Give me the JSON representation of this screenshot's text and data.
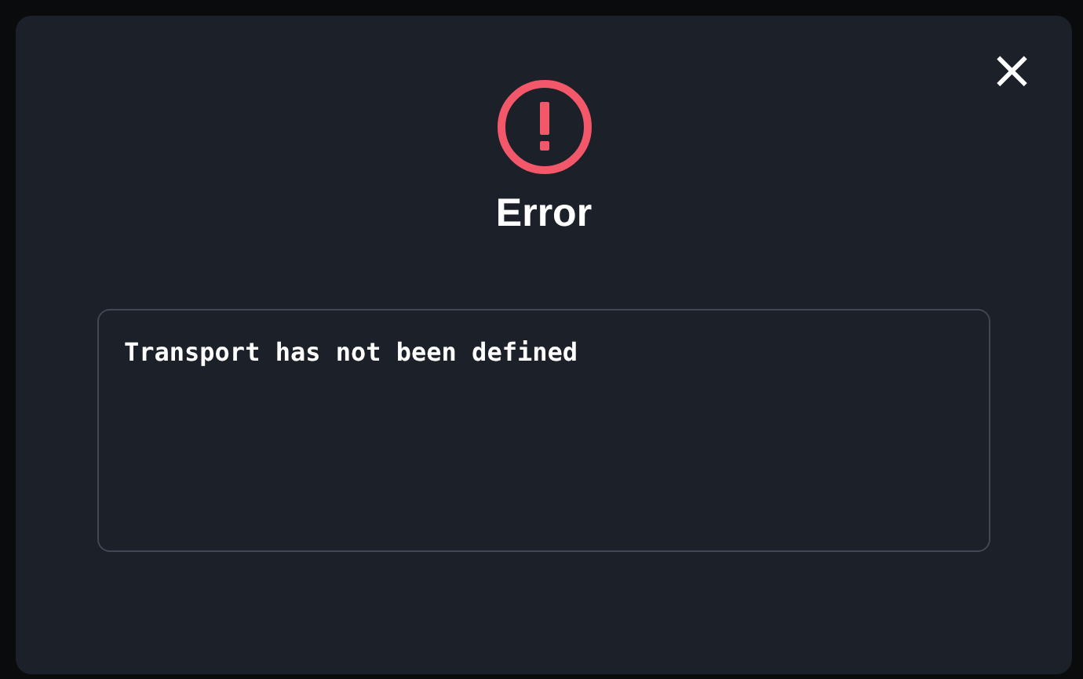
{
  "dialog": {
    "title": "Error",
    "message": "Transport has not been defined",
    "close_label": "×"
  }
}
